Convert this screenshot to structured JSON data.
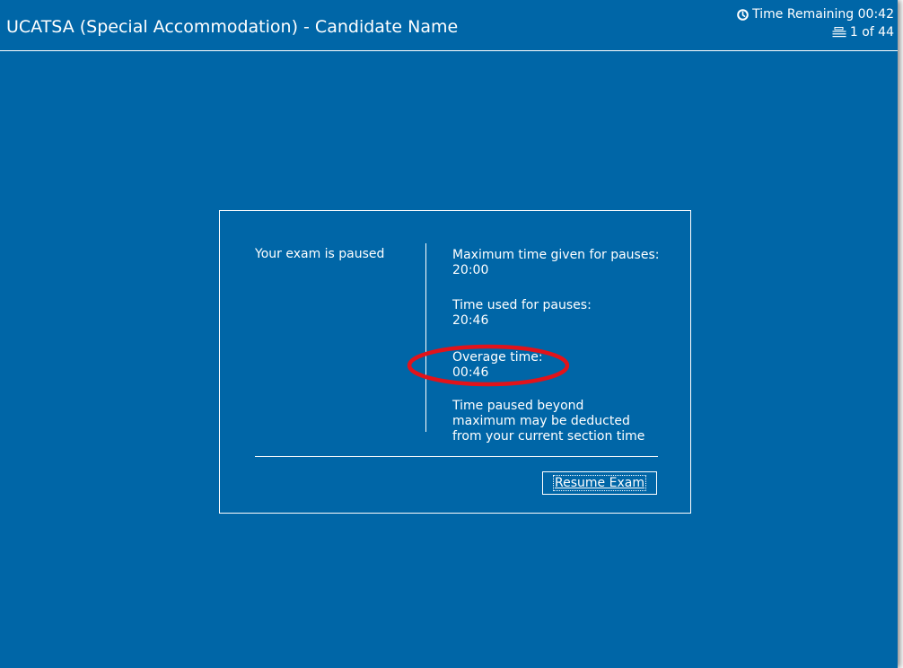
{
  "window": {
    "title": "UCATSA (Special Accommodation) - Candidate Name",
    "background_color": "#0066a7"
  },
  "header": {
    "timer_icon": "clock-icon",
    "time_remaining": "Time Remaining 00:42",
    "question_icon": "question-list-icon",
    "question_counter": "1 of 44"
  },
  "pause_dialog": {
    "status": "Your exam is paused",
    "max_pause_label": "Maximum time given for pauses:",
    "max_pause_value": "20:00",
    "used_pause_label": "Time used for pauses:",
    "used_pause_value": "20:46",
    "overage_label": "Overage time:",
    "overage_value": "00:46",
    "overage_highlight_color": "#e2131a",
    "note_line1": "Time paused beyond",
    "note_line2": "maximum may be deducted",
    "note_line3": "from your current section time",
    "resume_label": "Resume Exam"
  }
}
